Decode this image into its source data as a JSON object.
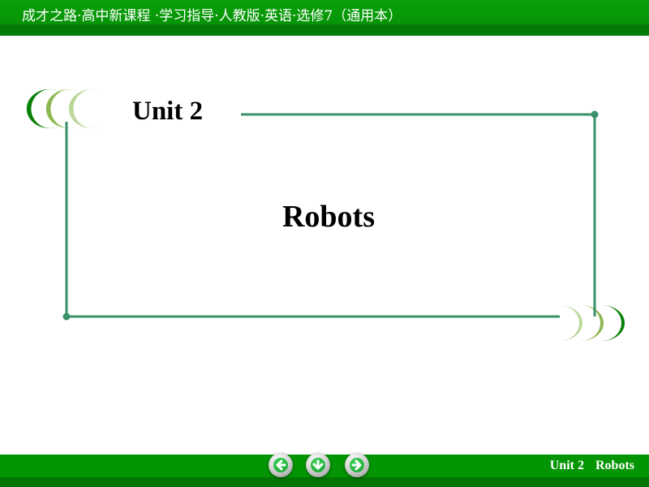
{
  "header": {
    "title": "成才之路·高中新课程 ·学习指导·人教版·英语·选修7（通用本）"
  },
  "slide": {
    "unit_label": "Unit 2",
    "title": "Robots"
  },
  "footer": {
    "unit": "Unit 2",
    "topic": "Robots",
    "nav": [
      {
        "name": "previous",
        "icon": "arrow-left-icon"
      },
      {
        "name": "home",
        "icon": "arrow-down-icon"
      },
      {
        "name": "next",
        "icon": "arrow-right-icon"
      }
    ]
  },
  "colors": {
    "header_green": "#069406",
    "frame_line": "#3a9068",
    "crescent_dark": "#068006",
    "crescent_mid": "#8db851",
    "crescent_light": "#bcd79a"
  }
}
